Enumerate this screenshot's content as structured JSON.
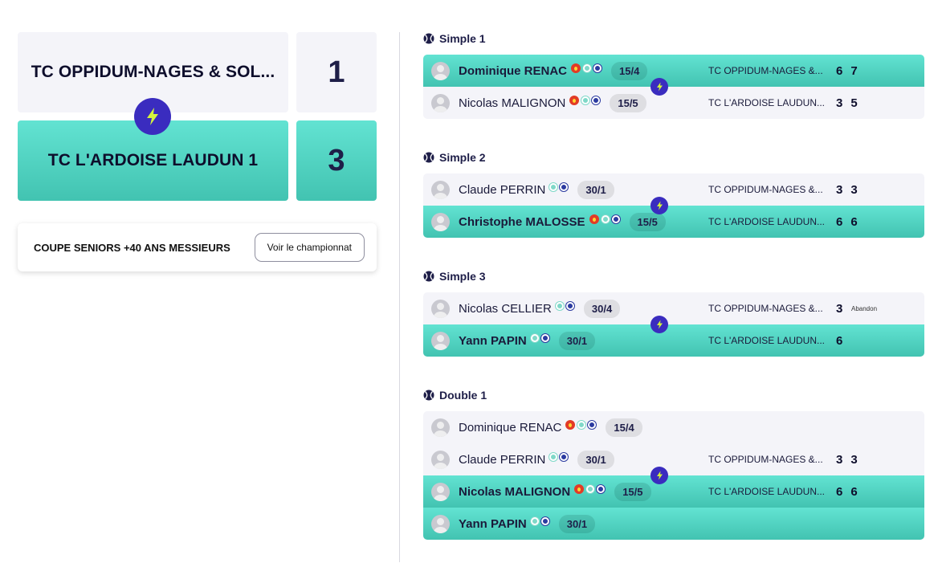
{
  "encounter": {
    "home_team": "TC OPPIDUM-NAGES & SOL...",
    "home_score": "1",
    "away_team": "TC L'ARDOISE LAUDUN 1",
    "away_score": "3",
    "competition": "COUPE SENIORS +40 ANS MESSIEURS",
    "championship_button": "Voir le championnat"
  },
  "matches": [
    {
      "title": "Simple 1",
      "rows": [
        {
          "name": "Dominique RENAC",
          "rank": "15/4",
          "club": "TC OPPIDUM-NAGES &...",
          "sets": [
            "6",
            "7"
          ],
          "winner": true
        },
        {
          "name": "Nicolas MALIGNON",
          "rank": "15/5",
          "club": "TC L'ARDOISE LAUDUN...",
          "sets": [
            "3",
            "5"
          ],
          "winner": false
        }
      ]
    },
    {
      "title": "Simple 2",
      "rows": [
        {
          "name": "Claude PERRIN",
          "rank": "30/1",
          "club": "TC OPPIDUM-NAGES &...",
          "sets": [
            "3",
            "3"
          ],
          "winner": false
        },
        {
          "name": "Christophe MALOSSE",
          "rank": "15/5",
          "club": "TC L'ARDOISE LAUDUN...",
          "sets": [
            "6",
            "6"
          ],
          "winner": true
        }
      ]
    },
    {
      "title": "Simple 3",
      "rows": [
        {
          "name": "Nicolas CELLIER",
          "rank": "30/4",
          "club": "TC OPPIDUM-NAGES &...",
          "sets": [
            "3"
          ],
          "note": "Abandon",
          "winner": false
        },
        {
          "name": "Yann PAPIN",
          "rank": "30/1",
          "club": "TC L'ARDOISE LAUDUN...",
          "sets": [
            "6"
          ],
          "winner": true
        }
      ]
    },
    {
      "title": "Double 1",
      "rows": [
        {
          "name": "Dominique RENAC",
          "rank": "15/4",
          "winner": false
        },
        {
          "name": "Claude PERRIN",
          "rank": "30/1",
          "club": "TC OPPIDUM-NAGES &...",
          "sets": [
            "3",
            "3"
          ],
          "winner": false
        },
        {
          "name": "Nicolas MALIGNON",
          "rank": "15/5",
          "club": "TC L'ARDOISE LAUDUN...",
          "sets": [
            "6",
            "6"
          ],
          "winner": true
        },
        {
          "name": "Yann PAPIN",
          "rank": "30/1",
          "winner": true
        }
      ]
    }
  ],
  "icons": {
    "winner_marker": "lightning-bolt-icon",
    "match_type": "tennis-ball-icon",
    "player_badges": [
      "fire-icon",
      "ball-icon",
      "medal-icon"
    ]
  },
  "colors": {
    "accent_teal": "#62e3d2",
    "accent_purple": "#3a2cbf",
    "bolt_yellow": "#d4f53c",
    "neutral_bg": "#f4f4f9"
  }
}
